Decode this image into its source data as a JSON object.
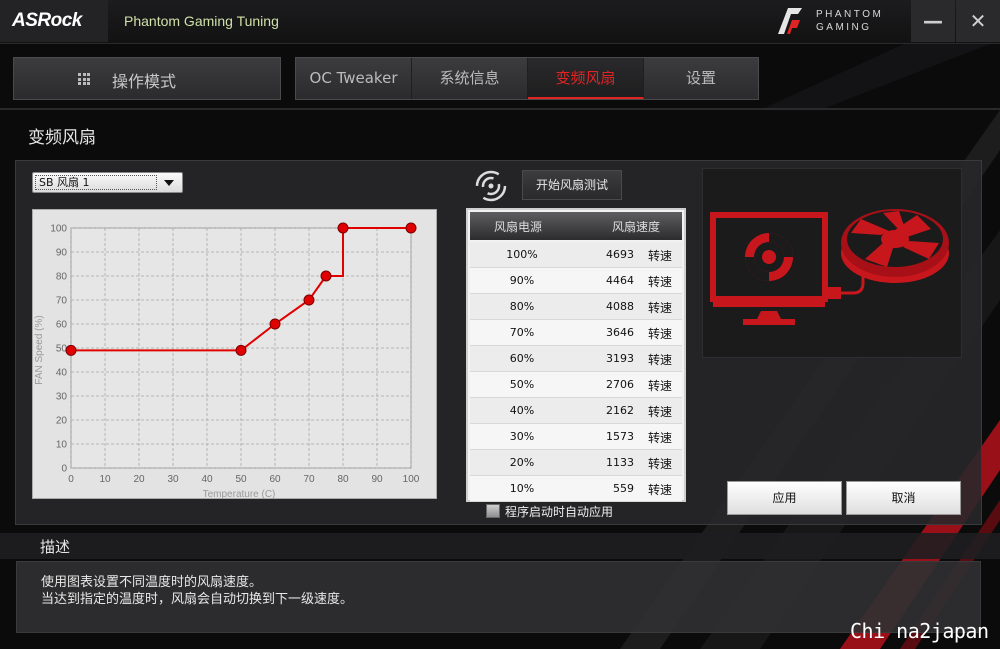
{
  "app": {
    "brand": "ASRock",
    "title": "Phantom Gaming Tuning",
    "pg_logo_line1": "PHANTOM",
    "pg_logo_line2": "GAMING"
  },
  "window": {
    "minimize_label": "—",
    "close_label": "✕"
  },
  "nav": {
    "mode_label": "操作模式",
    "tabs": [
      {
        "label": "OC Tweaker",
        "active": false
      },
      {
        "label": "系统信息",
        "active": false
      },
      {
        "label": "变频风扇",
        "active": true
      },
      {
        "label": "设置",
        "active": false
      }
    ]
  },
  "page": {
    "title": "变频风扇"
  },
  "fan_selector": {
    "value": "SB 风扇 1"
  },
  "test_button": {
    "label": "开始风扇测试"
  },
  "table": {
    "header_power": "风扇电源",
    "header_speed": "风扇速度",
    "rows": [
      {
        "power": "100%",
        "speed": "4693",
        "unit": "转速"
      },
      {
        "power": "90%",
        "speed": "4464",
        "unit": "转速"
      },
      {
        "power": "80%",
        "speed": "4088",
        "unit": "转速"
      },
      {
        "power": "70%",
        "speed": "3646",
        "unit": "转速"
      },
      {
        "power": "60%",
        "speed": "3193",
        "unit": "转速"
      },
      {
        "power": "50%",
        "speed": "2706",
        "unit": "转速"
      },
      {
        "power": "40%",
        "speed": "2162",
        "unit": "转速"
      },
      {
        "power": "30%",
        "speed": "1573",
        "unit": "转速"
      },
      {
        "power": "20%",
        "speed": "1133",
        "unit": "转速"
      },
      {
        "power": "10%",
        "speed": "559",
        "unit": "转速"
      }
    ]
  },
  "auto_apply": {
    "label": "程序启动时自动应用",
    "checked": false
  },
  "buttons": {
    "apply": "应用",
    "cancel": "取消"
  },
  "description": {
    "title": "描述",
    "line1": "使用图表设置不同温度时的风扇速度。",
    "line2": "当达到指定的温度时，风扇会自动切换到下一级速度。"
  },
  "watermark": "Chi na2japan",
  "colors": {
    "accent": "#e02424",
    "curve": "#e00000",
    "illustration": "#c8161d"
  },
  "chart_data": {
    "type": "line",
    "xlabel": "Temperature (C)",
    "ylabel": "FAN Speed (%)",
    "xlim": [
      0,
      100
    ],
    "ylim": [
      0,
      100
    ],
    "x_ticks": [
      0,
      10,
      20,
      30,
      40,
      50,
      60,
      70,
      80,
      90,
      100
    ],
    "y_ticks": [
      0,
      10,
      20,
      30,
      40,
      50,
      60,
      70,
      80,
      90,
      100
    ],
    "grid": true,
    "step": true,
    "points": [
      {
        "x": 0,
        "y": 49
      },
      {
        "x": 50,
        "y": 49
      },
      {
        "x": 60,
        "y": 60
      },
      {
        "x": 70,
        "y": 70
      },
      {
        "x": 75,
        "y": 80
      },
      {
        "x": 80,
        "y": 100
      },
      {
        "x": 100,
        "y": 100
      }
    ]
  }
}
